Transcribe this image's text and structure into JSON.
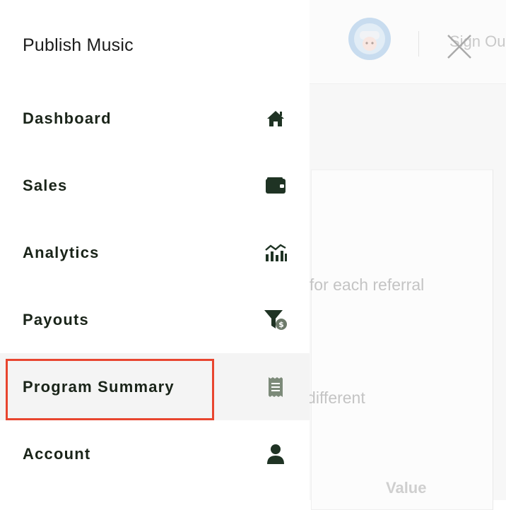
{
  "drawer": {
    "title": "Publish Music",
    "items": [
      {
        "label": "Dashboard",
        "icon": "home-icon"
      },
      {
        "label": "Sales",
        "icon": "wallet-icon"
      },
      {
        "label": "Analytics",
        "icon": "analytics-chart-icon"
      },
      {
        "label": "Payouts",
        "icon": "funnel-dollar-icon"
      },
      {
        "label": "Program Summary",
        "icon": "receipt-icon",
        "active": true
      },
      {
        "label": "Account",
        "icon": "user-icon"
      }
    ]
  },
  "background": {
    "sign_out": "Sign Ou",
    "text_1": "s for each referral",
    "text_2": "r different",
    "value_header": "Value"
  },
  "colors": {
    "icon_dark": "#1f3324",
    "icon_muted": "#6d7a6a",
    "highlight": "#e8452f",
    "active_bg": "#f4f4f4"
  }
}
